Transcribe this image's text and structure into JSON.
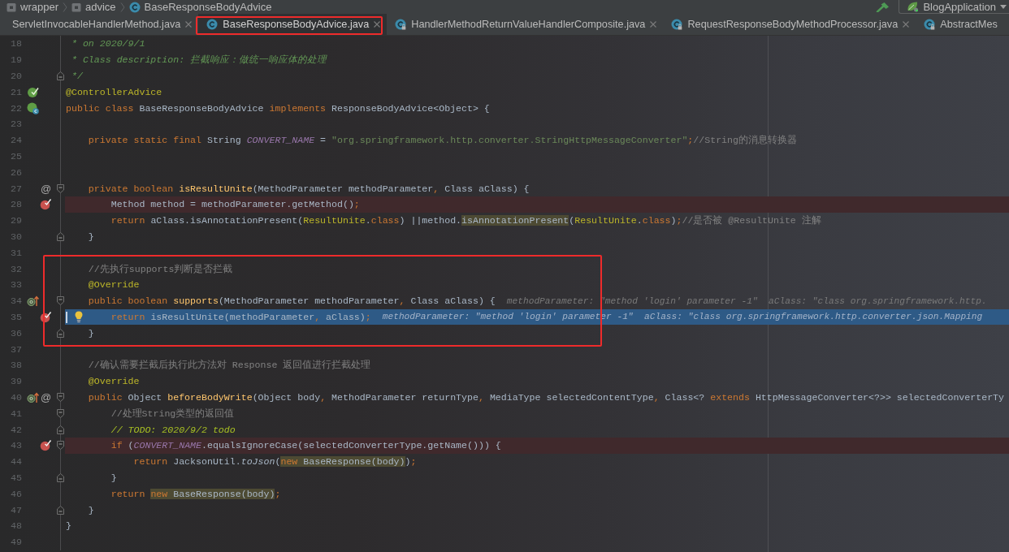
{
  "breadcrumbs": [
    {
      "label": "wrapper",
      "kind": "package"
    },
    {
      "label": "advice",
      "kind": "package"
    },
    {
      "label": "BaseResponseBodyAdvice",
      "kind": "class"
    }
  ],
  "run_configuration": {
    "label": "BlogApplication"
  },
  "tabs": [
    {
      "label": "ServletInvocableHandlerMethod.java",
      "selected": false,
      "framed": false,
      "close_button": true
    },
    {
      "label": "BaseResponseBodyAdvice.java",
      "icon": {
        "kind": "class",
        "locked": false
      },
      "selected": true,
      "framed": true,
      "close_button": true
    },
    {
      "label": "HandlerMethodReturnValueHandlerComposite.java",
      "icon": {
        "kind": "class",
        "locked": true
      },
      "selected": false,
      "framed": false,
      "close_button": true
    },
    {
      "label": "RequestResponseBodyMethodProcessor.java",
      "icon": {
        "kind": "class",
        "locked": true
      },
      "selected": false,
      "framed": false,
      "close_button": true
    },
    {
      "label": "AbstractMes",
      "icon": {
        "kind": "class",
        "locked": true
      },
      "selected": false,
      "framed": false,
      "close_button": false
    }
  ],
  "editor": {
    "lines": [
      {
        "number": "18",
        "tokens": [
          {
            "text": " * on 2020/9/1",
            "kind": "doc"
          }
        ],
        "breakpoint": false,
        "current": false,
        "framed": false
      },
      {
        "number": "19",
        "tokens": [
          {
            "text": " * Class description: 拦截响应：做统一响应体的处理",
            "kind": "doc"
          }
        ],
        "breakpoint": false,
        "current": false,
        "framed": false
      },
      {
        "number": "20",
        "tokens": [
          {
            "text": " */",
            "kind": "doc"
          }
        ],
        "fold": {
          "kind": "end"
        },
        "breakpoint": false,
        "current": false,
        "framed": false
      },
      {
        "number": "21",
        "tokens": [
          {
            "text": "@ControllerAdvice",
            "kind": "annotation"
          }
        ],
        "markers": [
          {
            "kind": "bean"
          }
        ],
        "breakpoint": false,
        "current": false,
        "framed": false
      },
      {
        "number": "22",
        "tokens": [
          {
            "text": "public class ",
            "kind": "keyword"
          },
          {
            "text": "BaseResponseBodyAdvice ",
            "kind": "plain"
          },
          {
            "text": "implements ",
            "kind": "keyword"
          },
          {
            "text": "ResponseBodyAdvice<Object> {",
            "kind": "plain"
          }
        ],
        "markers": [
          {
            "kind": "beanclass"
          }
        ],
        "breakpoint": false,
        "current": false,
        "framed": false
      },
      {
        "number": "23",
        "breakpoint": false,
        "current": false,
        "framed": false
      },
      {
        "number": "24",
        "tokens": [
          {
            "text": "    private static final ",
            "kind": "keyword"
          },
          {
            "text": "String ",
            "kind": "plain"
          },
          {
            "text": "CONVERT_NAME",
            "kind": "constant"
          },
          {
            "text": " = ",
            "kind": "plain"
          },
          {
            "text": "\"org.springframework.http.converter.StringHttpMessageConverter\"",
            "kind": "string"
          },
          {
            "text": ";",
            "kind": "keyword"
          },
          {
            "text": "//String的消息转换器",
            "kind": "comment"
          }
        ],
        "breakpoint": false,
        "current": false,
        "framed": false
      },
      {
        "number": "25",
        "breakpoint": false,
        "current": false,
        "framed": false
      },
      {
        "number": "26",
        "breakpoint": false,
        "current": false,
        "framed": false
      },
      {
        "number": "27",
        "tokens": [
          {
            "text": "    private boolean ",
            "kind": "keyword"
          },
          {
            "text": "isResultUnite",
            "kind": "declaration"
          },
          {
            "text": "(MethodParameter methodParameter",
            "kind": "plain"
          },
          {
            "text": ", ",
            "kind": "keyword"
          },
          {
            "text": "Class aClass) {",
            "kind": "plain"
          }
        ],
        "markers": [
          {
            "kind": "symbol",
            "text": "@"
          }
        ],
        "fold": {
          "kind": "start"
        },
        "breakpoint": false,
        "current": false,
        "framed": false
      },
      {
        "number": "28",
        "tokens": [
          {
            "text": "        Method method = methodParameter.getMethod()",
            "kind": "plain"
          },
          {
            "text": ";",
            "kind": "keyword"
          }
        ],
        "breakpoint": true,
        "current": false,
        "framed": false
      },
      {
        "number": "29",
        "tokens": [
          {
            "text": "        return ",
            "kind": "keyword"
          },
          {
            "text": "aClass.isAnnotationPresent(",
            "kind": "plain"
          },
          {
            "text": "ResultUnite",
            "kind": "annotation"
          },
          {
            "text": ".",
            "kind": "plain"
          },
          {
            "text": "class",
            "kind": "keyword"
          },
          {
            "text": ") ||method.",
            "kind": "plain"
          },
          {
            "kind": "usage",
            "parts": [
              {
                "text": "isAnnotationPresent",
                "kind": "plain"
              }
            ]
          },
          {
            "text": "(",
            "kind": "plain"
          },
          {
            "text": "ResultUnite",
            "kind": "annotation"
          },
          {
            "text": ".",
            "kind": "plain"
          },
          {
            "text": "class",
            "kind": "keyword"
          },
          {
            "text": ")",
            "kind": "plain"
          },
          {
            "text": ";",
            "kind": "keyword"
          },
          {
            "text": "//是否被 @ResultUnite 注解",
            "kind": "comment"
          }
        ],
        "breakpoint": false,
        "current": false,
        "framed": false
      },
      {
        "number": "30",
        "tokens": [
          {
            "text": "    }",
            "kind": "plain"
          }
        ],
        "fold": {
          "kind": "end"
        },
        "breakpoint": false,
        "current": false,
        "framed": false
      },
      {
        "number": "31",
        "breakpoint": false,
        "current": false,
        "framed": false
      },
      {
        "number": "32",
        "tokens": [
          {
            "text": "    //先执行supports判断是否拦截",
            "kind": "comment"
          }
        ],
        "breakpoint": false,
        "current": false,
        "framed": true
      },
      {
        "number": "33",
        "tokens": [
          {
            "text": "    @Override",
            "kind": "annotation"
          }
        ],
        "breakpoint": false,
        "current": false,
        "framed": true
      },
      {
        "number": "34",
        "tokens": [
          {
            "text": "    public boolean ",
            "kind": "keyword"
          },
          {
            "text": "supports",
            "kind": "declaration"
          },
          {
            "text": "(MethodParameter methodParameter",
            "kind": "plain"
          },
          {
            "text": ", ",
            "kind": "keyword"
          },
          {
            "text": "Class aClass) {",
            "kind": "plain"
          }
        ],
        "hint": "methodParameter: \"method 'login' parameter -1\"  aClass: \"class org.springframework.http.",
        "markers": [
          {
            "kind": "implements"
          }
        ],
        "fold": {
          "kind": "start"
        },
        "breakpoint": false,
        "current": false,
        "framed": true
      },
      {
        "number": "35",
        "tokens": [
          {
            "text": "        return ",
            "kind": "keyword"
          },
          {
            "text": "isResultUnite(methodParameter",
            "kind": "plain"
          },
          {
            "text": ", ",
            "kind": "keyword"
          },
          {
            "text": "aClass)",
            "kind": "plain"
          },
          {
            "text": ";",
            "kind": "keyword"
          }
        ],
        "hint": "methodParameter: \"method 'login' parameter -1\"  aClass: \"class org.springframework.http.converter.json.Mapping",
        "markers": [
          {
            "kind": "caret"
          },
          {
            "kind": "bulb"
          }
        ],
        "breakpoint": true,
        "current": true,
        "framed": true
      },
      {
        "number": "36",
        "tokens": [
          {
            "text": "    }",
            "kind": "plain"
          }
        ],
        "fold": {
          "kind": "end"
        },
        "breakpoint": false,
        "current": false,
        "framed": true
      },
      {
        "number": "37",
        "breakpoint": false,
        "current": false,
        "framed": false
      },
      {
        "number": "38",
        "tokens": [
          {
            "text": "    //确认需要拦截后执行此方法对 Response 返回值进行拦截处理",
            "kind": "comment"
          }
        ],
        "breakpoint": false,
        "current": false,
        "framed": false
      },
      {
        "number": "39",
        "tokens": [
          {
            "text": "    @Override",
            "kind": "annotation"
          }
        ],
        "breakpoint": false,
        "current": false,
        "framed": false
      },
      {
        "number": "40",
        "tokens": [
          {
            "text": "    public ",
            "kind": "keyword"
          },
          {
            "text": "Object ",
            "kind": "plain"
          },
          {
            "text": "beforeBodyWrite",
            "kind": "declaration"
          },
          {
            "text": "(Object body",
            "kind": "plain"
          },
          {
            "text": ", ",
            "kind": "keyword"
          },
          {
            "text": "MethodParameter returnType",
            "kind": "plain"
          },
          {
            "text": ", ",
            "kind": "keyword"
          },
          {
            "text": "MediaType selectedContentType",
            "kind": "plain"
          },
          {
            "text": ", ",
            "kind": "keyword"
          },
          {
            "text": "Class<? ",
            "kind": "plain"
          },
          {
            "text": "extends ",
            "kind": "keyword"
          },
          {
            "text": "HttpMessageConverter<?>> selectedConverterTy",
            "kind": "plain"
          }
        ],
        "markers": [
          {
            "kind": "implements"
          },
          {
            "kind": "symbol",
            "text": "@"
          }
        ],
        "fold": {
          "kind": "start"
        },
        "breakpoint": false,
        "current": false,
        "framed": false
      },
      {
        "number": "41",
        "tokens": [
          {
            "text": "        //处理String类型的返回值",
            "kind": "comment"
          }
        ],
        "fold": {
          "kind": "start"
        },
        "breakpoint": false,
        "current": false,
        "framed": false
      },
      {
        "number": "42",
        "tokens": [
          {
            "text": "        // TODO: 2020/9/2 todo",
            "kind": "todo"
          }
        ],
        "fold": {
          "kind": "end"
        },
        "breakpoint": false,
        "current": false,
        "framed": false
      },
      {
        "number": "43",
        "tokens": [
          {
            "text": "        if ",
            "kind": "keyword"
          },
          {
            "text": "(",
            "kind": "plain"
          },
          {
            "text": "CONVERT_NAME",
            "kind": "constant"
          },
          {
            "text": ".equalsIgnoreCase(selectedConverterType.getName())) {",
            "kind": "plain"
          }
        ],
        "fold": {
          "kind": "start"
        },
        "breakpoint": true,
        "current": false,
        "framed": false
      },
      {
        "number": "44",
        "tokens": [
          {
            "text": "            return ",
            "kind": "keyword"
          },
          {
            "text": "JacksonUtil.",
            "kind": "plain"
          },
          {
            "text": "toJson",
            "kind": "call"
          },
          {
            "text": "(",
            "kind": "plain"
          },
          {
            "kind": "usage",
            "parts": [
              {
                "text": "new ",
                "kind": "keyword"
              },
              {
                "text": "BaseResponse(body)",
                "kind": "plain"
              }
            ]
          },
          {
            "text": ")",
            "kind": "plain"
          },
          {
            "text": ";",
            "kind": "keyword"
          }
        ],
        "breakpoint": false,
        "current": false,
        "framed": false
      },
      {
        "number": "45",
        "tokens": [
          {
            "text": "        }",
            "kind": "plain"
          }
        ],
        "fold": {
          "kind": "end"
        },
        "breakpoint": false,
        "current": false,
        "framed": false
      },
      {
        "number": "46",
        "tokens": [
          {
            "text": "        return ",
            "kind": "keyword"
          },
          {
            "kind": "usage",
            "parts": [
              {
                "text": "new ",
                "kind": "keyword"
              },
              {
                "text": "BaseResponse(body)",
                "kind": "plain"
              }
            ]
          },
          {
            "text": ";",
            "kind": "keyword"
          }
        ],
        "breakpoint": false,
        "current": false,
        "framed": false
      },
      {
        "number": "47",
        "tokens": [
          {
            "text": "    }",
            "kind": "plain"
          }
        ],
        "fold": {
          "kind": "end"
        },
        "breakpoint": false,
        "current": false,
        "framed": false
      },
      {
        "number": "48",
        "tokens": [
          {
            "text": "}",
            "kind": "plain"
          }
        ],
        "breakpoint": false,
        "current": false,
        "framed": false
      },
      {
        "number": "49",
        "breakpoint": false,
        "current": false,
        "framed": false
      }
    ]
  }
}
